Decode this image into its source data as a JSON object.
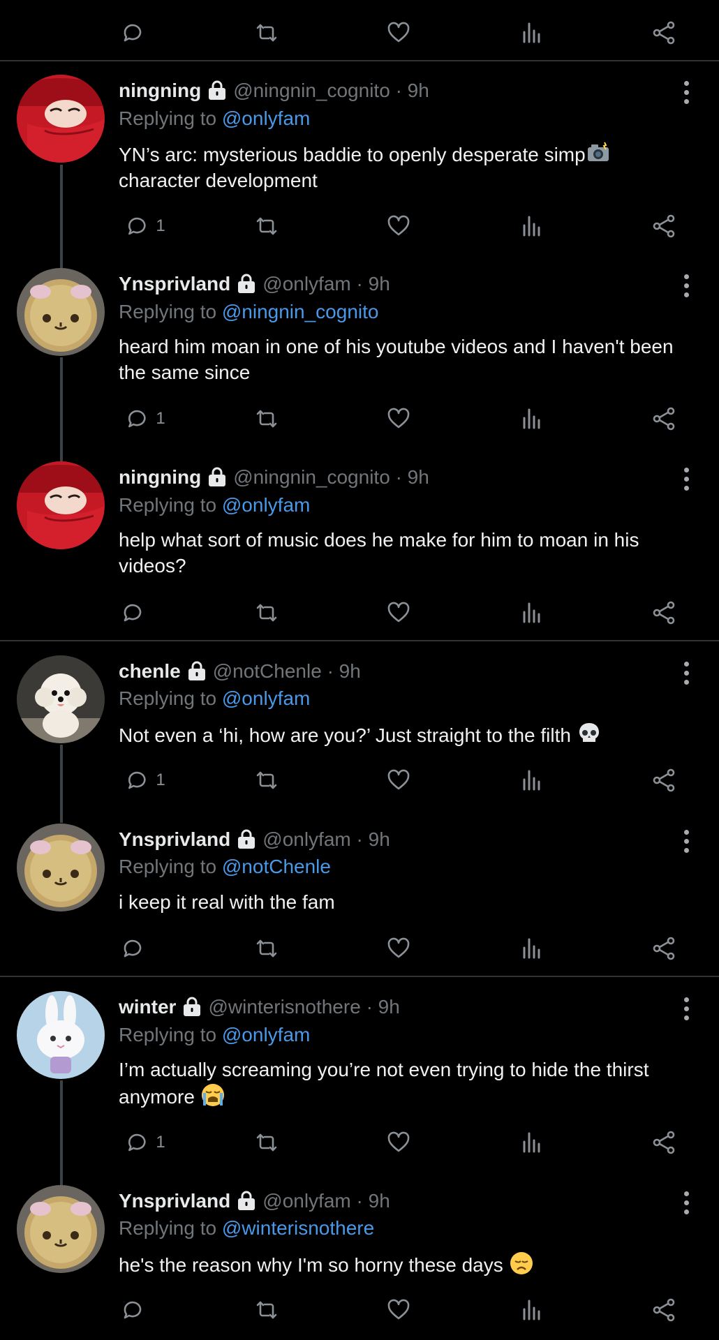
{
  "theme": {
    "background": "#000000",
    "link": "#4a99e9",
    "muted": "#71767b",
    "divider": "#2f3336"
  },
  "replying_label": "Replying to",
  "top_actions": {
    "reply_count": ""
  },
  "tweets": [
    {
      "name": "ningning",
      "handle": "@ningnin_cognito",
      "time": "· 9h",
      "replying_to": "@onlyfam",
      "text": "YN’s arc: mysterious baddie to openly desperate simp",
      "text_tail": "character development",
      "emoji": "camera-with-flash",
      "reply_count": "1",
      "avatar": "red-hood"
    },
    {
      "name": "Ynsprivland",
      "handle": "@onlyfam",
      "time": "· 9h",
      "replying_to": "@ningnin_cognito",
      "text": " heard him moan in one of his youtube videos and I haven't been the same since",
      "reply_count": "1",
      "avatar": "golden-plush"
    },
    {
      "name": "ningning",
      "handle": "@ningnin_cognito",
      "time": "· 9h",
      "replying_to": "@onlyfam",
      "text": "help what sort of music does he make for him to moan in his videos?",
      "reply_count": "",
      "avatar": "red-hood"
    },
    {
      "name": "chenle",
      "handle": "@notChenle",
      "time": "· 9h",
      "replying_to": "@onlyfam",
      "text": "Not even a ‘hi, how are you?’ Just straight to the filth",
      "emoji": "skull",
      "reply_count": "1",
      "avatar": "white-puppy"
    },
    {
      "name": "Ynsprivland",
      "handle": "@onlyfam",
      "time": "· 9h",
      "replying_to": "@notChenle",
      "text": "i keep it real with the fam",
      "reply_count": "",
      "avatar": "golden-plush"
    },
    {
      "name": "winter",
      "handle": "@winterisnothere",
      "time": "· 9h",
      "replying_to": "@onlyfam",
      "text": "I’m actually screaming you’re not even trying to hide the thirst anymore",
      "emoji": "loudly-crying-face",
      "reply_count": "1",
      "avatar": "white-bunny"
    },
    {
      "name": "Ynsprivland",
      "handle": "@onlyfam",
      "time": "· 9h",
      "replying_to": "@winterisnothere",
      "text": "he's the reason why I'm so horny these days",
      "emoji": "disappointed-face",
      "reply_count": "",
      "avatar": "golden-plush"
    }
  ]
}
